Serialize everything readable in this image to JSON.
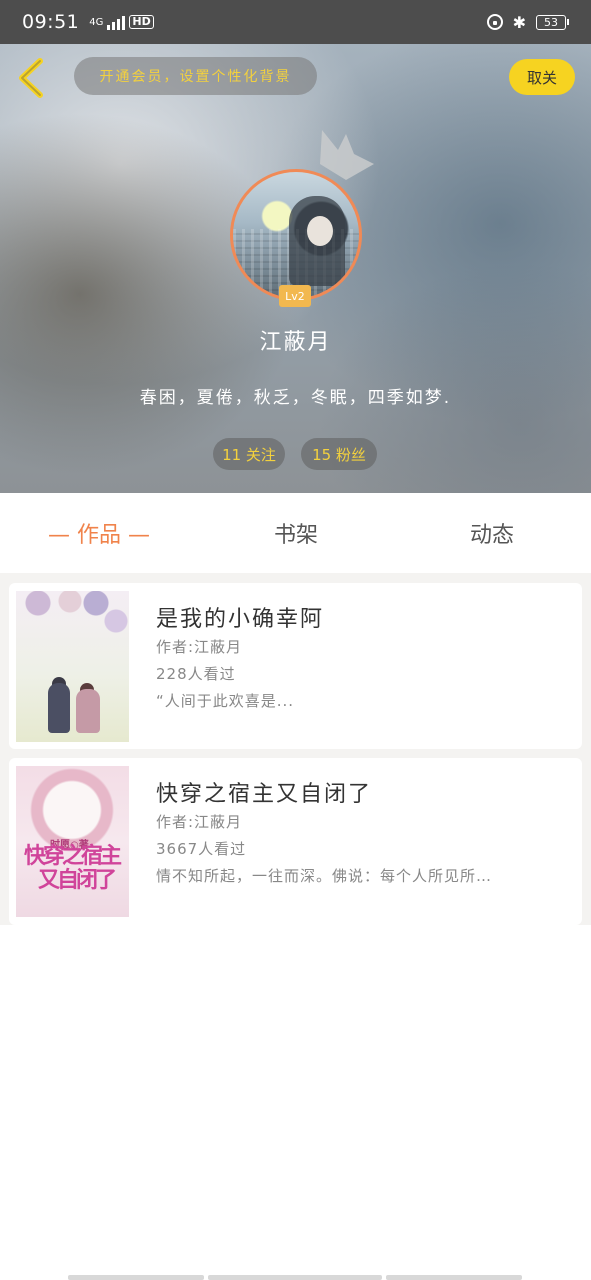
{
  "status_bar": {
    "time": "09:51",
    "network": "4G",
    "hd_label": "HD",
    "battery": "53"
  },
  "header": {
    "vip_prompt": "开通会员，设置个性化背景",
    "unfollow_label": "取关",
    "level": "Lv2",
    "username": "江蔽月",
    "bio": "春困，夏倦，秋乏，冬眠，四季如梦.",
    "following": "11 关注",
    "fans": "15 粉丝",
    "accent": "#f6d321"
  },
  "tabs": {
    "works": "— 作品 —",
    "shelf": "书架",
    "feed": "动态",
    "active_color": "#f0834b"
  },
  "books": [
    {
      "title": "是我的小确幸阿",
      "author": "作者:江蔽月",
      "views": "228人看过",
      "excerpt": "“人间于此欢喜是..."
    },
    {
      "title": "快穿之宿主又自闭了",
      "author": "作者:江蔽月",
      "views": "3667人看过",
      "excerpt": "情不知所起，一往而深。佛说：每个人所见所…",
      "cover_author": "时愿○著",
      "cover_title_line1": "快穿之宿主",
      "cover_title_line2": "又自闭了"
    }
  ]
}
